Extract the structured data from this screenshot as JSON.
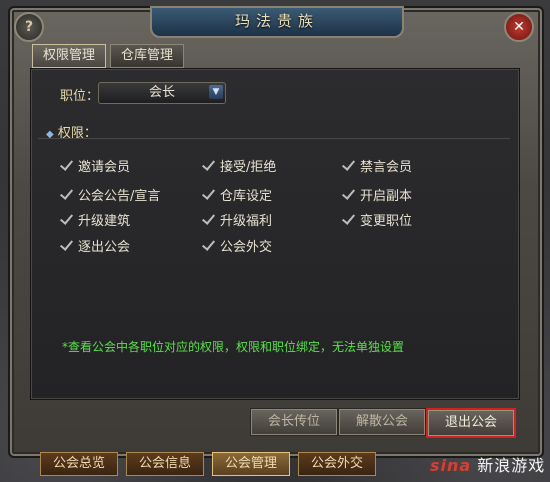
{
  "window": {
    "title": "玛法贵族"
  },
  "tabs": [
    "权限管理",
    "仓库管理"
  ],
  "position": {
    "label": "职位：",
    "selected": "会长"
  },
  "permissions_label": "权限：",
  "permissions": [
    "邀请会员",
    "接受/拒绝",
    "禁言会员",
    "公会公告/宣言",
    "仓库设定",
    "开启副本",
    "升级建筑",
    "升级福利",
    "变更职位",
    "逐出公会",
    "公会外交"
  ],
  "note": "*查看公会中各职位对应的权限，权限和职位绑定，无法单独设置",
  "buttons": [
    "会长传位",
    "解散公会",
    "退出公会"
  ],
  "bottom_tabs": [
    "公会总览",
    "公会信息",
    "公会管理",
    "公会外交"
  ],
  "watermark": {
    "brand": "sina",
    "text": "新浪游戏"
  }
}
